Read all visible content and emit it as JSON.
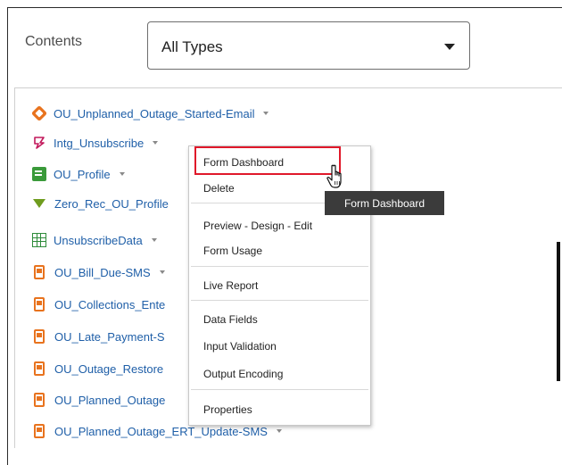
{
  "contents_label": "Contents",
  "type_filter": {
    "selected": "All Types"
  },
  "items": [
    {
      "name": "OU_Unplanned_Outage_Started-Email",
      "icon": "email-icon"
    },
    {
      "name": "Intg_Unsubscribe",
      "icon": "form-icon"
    },
    {
      "name": "OU_Profile",
      "icon": "profile-icon"
    },
    {
      "name": "Zero_Rec_OU_Profile",
      "icon": "filter-icon"
    },
    {
      "name": "UnsubscribeData",
      "icon": "table-icon"
    },
    {
      "name": "OU_Bill_Due-SMS",
      "icon": "sms-icon"
    },
    {
      "name": "OU_Collections_Ente",
      "icon": "sms-icon"
    },
    {
      "name": "OU_Late_Payment-S",
      "icon": "sms-icon"
    },
    {
      "name": "OU_Outage_Restore",
      "icon": "sms-icon"
    },
    {
      "name": "OU_Planned_Outage",
      "icon": "sms-icon"
    },
    {
      "name": "OU_Planned_Outage_ERT_Update-SMS",
      "icon": "sms-icon"
    }
  ],
  "context_menu": {
    "form_dashboard": "Form Dashboard",
    "delete": "Delete",
    "preview_design_edit": "Preview - Design - Edit",
    "form_usage": "Form Usage",
    "live_report": "Live Report",
    "data_fields": "Data Fields",
    "input_validation": "Input Validation",
    "output_encoding": "Output Encoding",
    "properties": "Properties"
  },
  "tooltip": "Form Dashboard",
  "colors": {
    "link": "#1f5fa8",
    "highlight": "#e0182a",
    "sms": "#e8731e",
    "tooltip_bg": "#3b3b3b"
  }
}
